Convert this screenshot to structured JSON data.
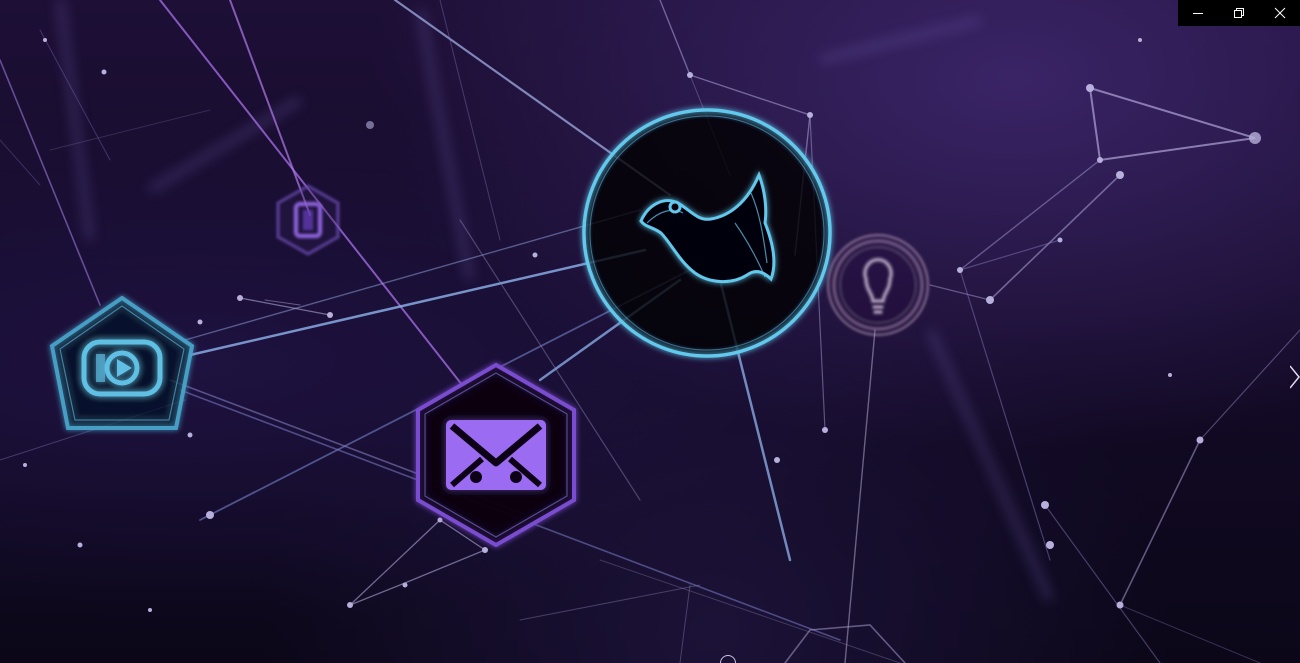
{
  "window_controls": {
    "minimize_icon": "minimize-icon",
    "restore_icon": "restore-icon",
    "close_icon": "close-icon"
  },
  "nodes": [
    {
      "id": "twitter",
      "icon": "bird-icon",
      "shape": "circle",
      "color": "#62c8ec"
    },
    {
      "id": "lightbulb",
      "icon": "lightbulb-icon",
      "shape": "circle",
      "color": "#c9a6c8"
    },
    {
      "id": "mail",
      "icon": "envelope-icon",
      "shape": "hexagon",
      "color": "#9b6cf2"
    },
    {
      "id": "media",
      "icon": "media-icon",
      "shape": "pentagon",
      "color": "#5ec0e4"
    },
    {
      "id": "phone",
      "icon": "phone-icon",
      "shape": "hexagon",
      "color": "#7a56c8"
    }
  ],
  "colors": {
    "background": "#150b2a",
    "line_blue": "#8fb4ee",
    "line_purple": "#a06ae0",
    "line_gray": "#8e88b8"
  },
  "navigation": {
    "next_icon": "chevron-right-icon"
  }
}
